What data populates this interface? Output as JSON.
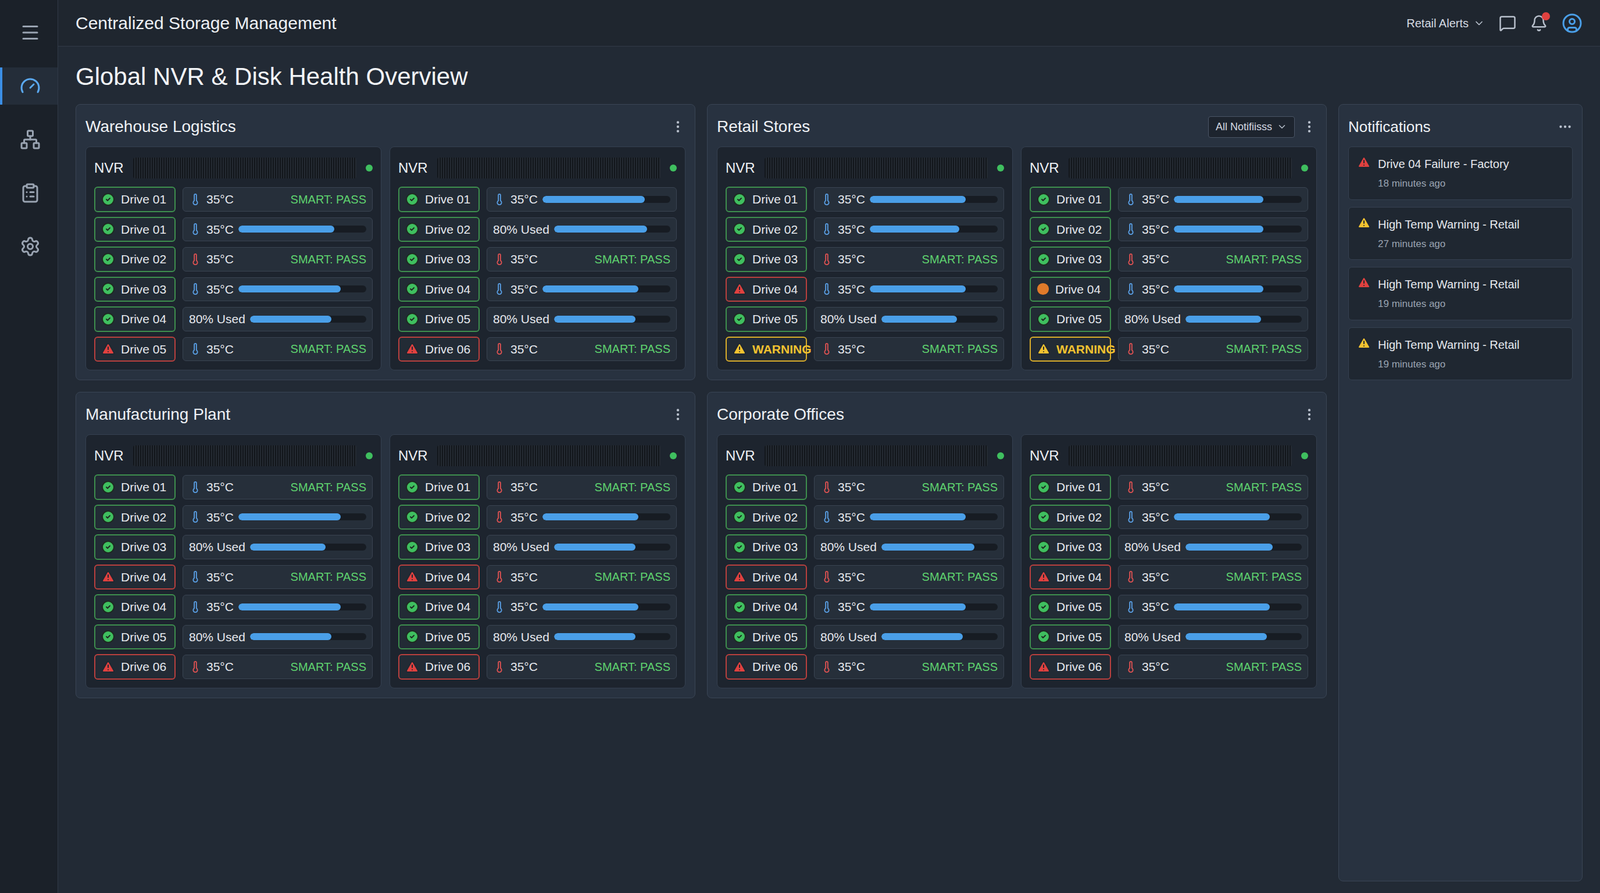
{
  "app": {
    "title": "Centralized Storage Management",
    "page_title": "Global NVR & Disk Health Overview"
  },
  "sidebar": {
    "items": [
      {
        "icon": "menu",
        "selected": false
      },
      {
        "icon": "dashboard",
        "selected": true
      },
      {
        "icon": "network",
        "selected": false
      },
      {
        "icon": "reports",
        "selected": false
      },
      {
        "icon": "settings",
        "selected": false
      }
    ]
  },
  "header": {
    "filter": "Retail Alerts",
    "bell_badge": true
  },
  "sites": [
    {
      "name": "Warehouse Logistics",
      "filter": null,
      "nvrs": [
        {
          "label": "NVR",
          "online": true,
          "drives": [
            {
              "label": "Drive 01",
              "status": "ok",
              "reading": "35°C",
              "thermometer": true,
              "thermo_color": "#5aa0e6",
              "kind": "smart",
              "smart": "SMART: PASS"
            },
            {
              "label": "Drive 01",
              "status": "ok",
              "reading": "35°C",
              "thermometer": true,
              "thermo_color": "#5aa0e6",
              "kind": "bar",
              "level": 0.75
            },
            {
              "label": "Drive 02",
              "status": "ok",
              "reading": "35°C",
              "thermometer": true,
              "thermo_color": "#e05252",
              "kind": "smart",
              "smart": "SMART: PASS"
            },
            {
              "label": "Drive 03",
              "status": "ok",
              "reading": "35°C",
              "thermometer": true,
              "thermo_color": "#5aa0e6",
              "kind": "bar",
              "level": 0.8
            },
            {
              "label": "Drive 04",
              "status": "ok",
              "reading": "80% Used",
              "thermometer": false,
              "thermo_color": "#5aa0e6",
              "kind": "bar",
              "level": 0.7
            },
            {
              "label": "Drive 05",
              "status": "fail",
              "reading": "35°C",
              "thermometer": true,
              "thermo_color": "#5aa0e6",
              "kind": "smart",
              "smart": "SMART: PASS"
            }
          ]
        },
        {
          "label": "NVR",
          "online": true,
          "drives": [
            {
              "label": "Drive 01",
              "status": "ok",
              "reading": "35°C",
              "thermometer": true,
              "thermo_color": "#5aa0e6",
              "kind": "bar",
              "level": 0.8
            },
            {
              "label": "Drive 02",
              "status": "ok",
              "reading": "80% Used",
              "thermometer": false,
              "thermo_color": "#5aa0e6",
              "kind": "bar",
              "level": 0.8
            },
            {
              "label": "Drive 03",
              "status": "ok",
              "reading": "35°C",
              "thermometer": true,
              "thermo_color": "#e05252",
              "kind": "smart",
              "smart": "SMART: PASS"
            },
            {
              "label": "Drive 04",
              "status": "ok",
              "reading": "35°C",
              "thermometer": true,
              "thermo_color": "#5aa0e6",
              "kind": "bar",
              "level": 0.75
            },
            {
              "label": "Drive 05",
              "status": "ok",
              "reading": "80% Used",
              "thermometer": false,
              "thermo_color": "#5aa0e6",
              "kind": "bar",
              "level": 0.7
            },
            {
              "label": "Drive 06",
              "status": "fail",
              "reading": "35°C",
              "thermometer": true,
              "thermo_color": "#e05252",
              "kind": "smart",
              "smart": "SMART: PASS"
            }
          ]
        }
      ]
    },
    {
      "name": "Retail Stores",
      "filter": "All Notifiisss",
      "nvrs": [
        {
          "label": "NVR",
          "online": true,
          "drives": [
            {
              "label": "Drive 01",
              "status": "ok",
              "reading": "35°C",
              "thermometer": true,
              "thermo_color": "#5aa0e6",
              "kind": "bar",
              "level": 0.75
            },
            {
              "label": "Drive 02",
              "status": "ok",
              "reading": "35°C",
              "thermometer": true,
              "thermo_color": "#5aa0e6",
              "kind": "bar",
              "level": 0.7
            },
            {
              "label": "Drive 03",
              "status": "ok",
              "reading": "35°C",
              "thermometer": true,
              "thermo_color": "#e05252",
              "kind": "smart",
              "smart": "SMART: PASS"
            },
            {
              "label": "Drive 04",
              "status": "fail",
              "reading": "35°C",
              "thermometer": true,
              "thermo_color": "#5aa0e6",
              "kind": "bar",
              "level": 0.75
            },
            {
              "label": "Drive 05",
              "status": "ok",
              "reading": "80% Used",
              "thermometer": false,
              "thermo_color": "#5aa0e6",
              "kind": "bar",
              "level": 0.65
            },
            {
              "label": "WARNING",
              "status": "warn",
              "reading": "35°C",
              "thermometer": true,
              "thermo_color": "#e05252",
              "kind": "smart",
              "smart": "SMART: PASS"
            }
          ]
        },
        {
          "label": "NVR",
          "online": true,
          "drives": [
            {
              "label": "Drive 01",
              "status": "ok",
              "reading": "35°C",
              "thermometer": true,
              "thermo_color": "#5aa0e6",
              "kind": "bar",
              "level": 0.7
            },
            {
              "label": "Drive 02",
              "status": "ok",
              "reading": "35°C",
              "thermometer": true,
              "thermo_color": "#5aa0e6",
              "kind": "bar",
              "level": 0.7
            },
            {
              "label": "Drive 03",
              "status": "ok",
              "reading": "35°C",
              "thermometer": true,
              "thermo_color": "#e05252",
              "kind": "smart",
              "smart": "SMART: PASS"
            },
            {
              "label": "Drive 04",
              "status": "alert",
              "reading": "35°C",
              "thermometer": true,
              "thermo_color": "#5aa0e6",
              "kind": "bar",
              "level": 0.7
            },
            {
              "label": "Drive 05",
              "status": "ok",
              "reading": "80% Used",
              "thermometer": false,
              "thermo_color": "#5aa0e6",
              "kind": "bar",
              "level": 0.65
            },
            {
              "label": "WARNING",
              "status": "warn",
              "reading": "35°C",
              "thermometer": true,
              "thermo_color": "#e05252",
              "kind": "smart",
              "smart": "SMART: PASS"
            }
          ]
        }
      ]
    },
    {
      "name": "Manufacturing Plant",
      "filter": null,
      "nvrs": [
        {
          "label": "NVR",
          "online": true,
          "drives": [
            {
              "label": "Drive 01",
              "status": "ok",
              "reading": "35°C",
              "thermometer": true,
              "thermo_color": "#5aa0e6",
              "kind": "smart",
              "smart": "SMART: PASS"
            },
            {
              "label": "Drive 02",
              "status": "ok",
              "reading": "35°C",
              "thermometer": true,
              "thermo_color": "#5aa0e6",
              "kind": "bar",
              "level": 0.8
            },
            {
              "label": "Drive 03",
              "status": "ok",
              "reading": "80% Used",
              "thermometer": false,
              "thermo_color": "#5aa0e6",
              "kind": "bar",
              "level": 0.65
            },
            {
              "label": "Drive 04",
              "status": "fail",
              "reading": "35°C",
              "thermometer": true,
              "thermo_color": "#5aa0e6",
              "kind": "smart",
              "smart": "SMART: PASS"
            },
            {
              "label": "Drive 04",
              "status": "ok",
              "reading": "35°C",
              "thermometer": true,
              "thermo_color": "#5aa0e6",
              "kind": "bar",
              "level": 0.8
            },
            {
              "label": "Drive 05",
              "status": "ok",
              "reading": "80% Used",
              "thermometer": false,
              "thermo_color": "#5aa0e6",
              "kind": "bar",
              "level": 0.7
            },
            {
              "label": "Drive 06",
              "status": "fail",
              "reading": "35°C",
              "thermometer": true,
              "thermo_color": "#e05252",
              "kind": "smart",
              "smart": "SMART: PASS"
            }
          ]
        },
        {
          "label": "NVR",
          "online": true,
          "drives": [
            {
              "label": "Drive 01",
              "status": "ok",
              "reading": "35°C",
              "thermometer": true,
              "thermo_color": "#e05252",
              "kind": "smart",
              "smart": "SMART: PASS"
            },
            {
              "label": "Drive 02",
              "status": "ok",
              "reading": "35°C",
              "thermometer": true,
              "thermo_color": "#e05252",
              "kind": "bar",
              "level": 0.75
            },
            {
              "label": "Drive 03",
              "status": "ok",
              "reading": "80% Used",
              "thermometer": false,
              "thermo_color": "#5aa0e6",
              "kind": "bar",
              "level": 0.7
            },
            {
              "label": "Drive 04",
              "status": "fail",
              "reading": "35°C",
              "thermometer": true,
              "thermo_color": "#e05252",
              "kind": "smart",
              "smart": "SMART: PASS"
            },
            {
              "label": "Drive 04",
              "status": "ok",
              "reading": "35°C",
              "thermometer": true,
              "thermo_color": "#5aa0e6",
              "kind": "bar",
              "level": 0.75
            },
            {
              "label": "Drive 05",
              "status": "ok",
              "reading": "80% Used",
              "thermometer": false,
              "thermo_color": "#5aa0e6",
              "kind": "bar",
              "level": 0.7
            },
            {
              "label": "Drive 06",
              "status": "fail",
              "reading": "35°C",
              "thermometer": true,
              "thermo_color": "#e05252",
              "kind": "smart",
              "smart": "SMART: PASS"
            }
          ]
        }
      ]
    },
    {
      "name": "Corporate Offices",
      "filter": null,
      "nvrs": [
        {
          "label": "NVR",
          "online": true,
          "drives": [
            {
              "label": "Drive 01",
              "status": "ok",
              "reading": "35°C",
              "thermometer": true,
              "thermo_color": "#e05252",
              "kind": "smart",
              "smart": "SMART: PASS"
            },
            {
              "label": "Drive 02",
              "status": "ok",
              "reading": "35°C",
              "thermometer": true,
              "thermo_color": "#5aa0e6",
              "kind": "bar",
              "level": 0.75
            },
            {
              "label": "Drive 03",
              "status": "ok",
              "reading": "80% Used",
              "thermometer": false,
              "thermo_color": "#5aa0e6",
              "kind": "bar",
              "level": 0.8
            },
            {
              "label": "Drive 04",
              "status": "fail",
              "reading": "35°C",
              "thermometer": true,
              "thermo_color": "#e05252",
              "kind": "smart",
              "smart": "SMART: PASS"
            },
            {
              "label": "Drive 04",
              "status": "ok",
              "reading": "35°C",
              "thermometer": true,
              "thermo_color": "#5aa0e6",
              "kind": "bar",
              "level": 0.75
            },
            {
              "label": "Drive 05",
              "status": "ok",
              "reading": "80% Used",
              "thermometer": false,
              "thermo_color": "#5aa0e6",
              "kind": "bar",
              "level": 0.7
            },
            {
              "label": "Drive 06",
              "status": "fail",
              "reading": "35°C",
              "thermometer": true,
              "thermo_color": "#e05252",
              "kind": "smart",
              "smart": "SMART: PASS"
            }
          ]
        },
        {
          "label": "NVR",
          "online": true,
          "drives": [
            {
              "label": "Drive 01",
              "status": "ok",
              "reading": "35°C",
              "thermometer": true,
              "thermo_color": "#e05252",
              "kind": "smart",
              "smart": "SMART: PASS"
            },
            {
              "label": "Drive 02",
              "status": "ok",
              "reading": "35°C",
              "thermometer": true,
              "thermo_color": "#5aa0e6",
              "kind": "bar",
              "level": 0.75
            },
            {
              "label": "Drive 03",
              "status": "ok",
              "reading": "80% Used",
              "thermometer": false,
              "thermo_color": "#5aa0e6",
              "kind": "bar",
              "level": 0.75
            },
            {
              "label": "Drive 04",
              "status": "fail",
              "reading": "35°C",
              "thermometer": true,
              "thermo_color": "#e05252",
              "kind": "smart",
              "smart": "SMART: PASS"
            },
            {
              "label": "Drive 05",
              "status": "ok",
              "reading": "35°C",
              "thermometer": true,
              "thermo_color": "#5aa0e6",
              "kind": "bar",
              "level": 0.75
            },
            {
              "label": "Drive 05",
              "status": "ok",
              "reading": "80% Used",
              "thermometer": false,
              "thermo_color": "#5aa0e6",
              "kind": "bar",
              "level": 0.7
            },
            {
              "label": "Drive 06",
              "status": "fail",
              "reading": "35°C",
              "thermometer": true,
              "thermo_color": "#e05252",
              "kind": "smart",
              "smart": "SMART: PASS"
            }
          ]
        }
      ]
    }
  ],
  "notifications": {
    "title": "Notifications",
    "items": [
      {
        "status": "fail",
        "title": "Drive 04 Failure - Factory",
        "time": "18 minutes ago"
      },
      {
        "status": "warn",
        "title": "High Temp Warning - Retail",
        "time": "27 minutes ago"
      },
      {
        "status": "fail",
        "title": "High Temp Warning - Retail",
        "time": "19 minutes ago"
      },
      {
        "status": "warn",
        "title": "High Temp Warning - Retail",
        "time": "19 minutes ago"
      }
    ]
  }
}
